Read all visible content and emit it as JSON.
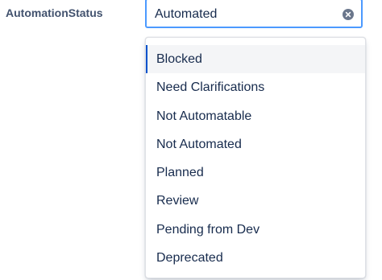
{
  "field": {
    "label": "AutomationStatus",
    "selected_value": "Automated",
    "clear_icon": "clear-circle-x-icon"
  },
  "dropdown": {
    "highlighted_index": 0,
    "options": [
      {
        "label": "Blocked"
      },
      {
        "label": "Need Clarifications"
      },
      {
        "label": "Not Automatable"
      },
      {
        "label": "Not Automated"
      },
      {
        "label": "Planned"
      },
      {
        "label": "Review"
      },
      {
        "label": "Pending from Dev"
      },
      {
        "label": "Deprecated"
      }
    ]
  },
  "colors": {
    "focus_border": "#4c9aff",
    "active_indicator": "#0052cc",
    "label_text": "#42526e",
    "option_text": "#172b4d"
  }
}
